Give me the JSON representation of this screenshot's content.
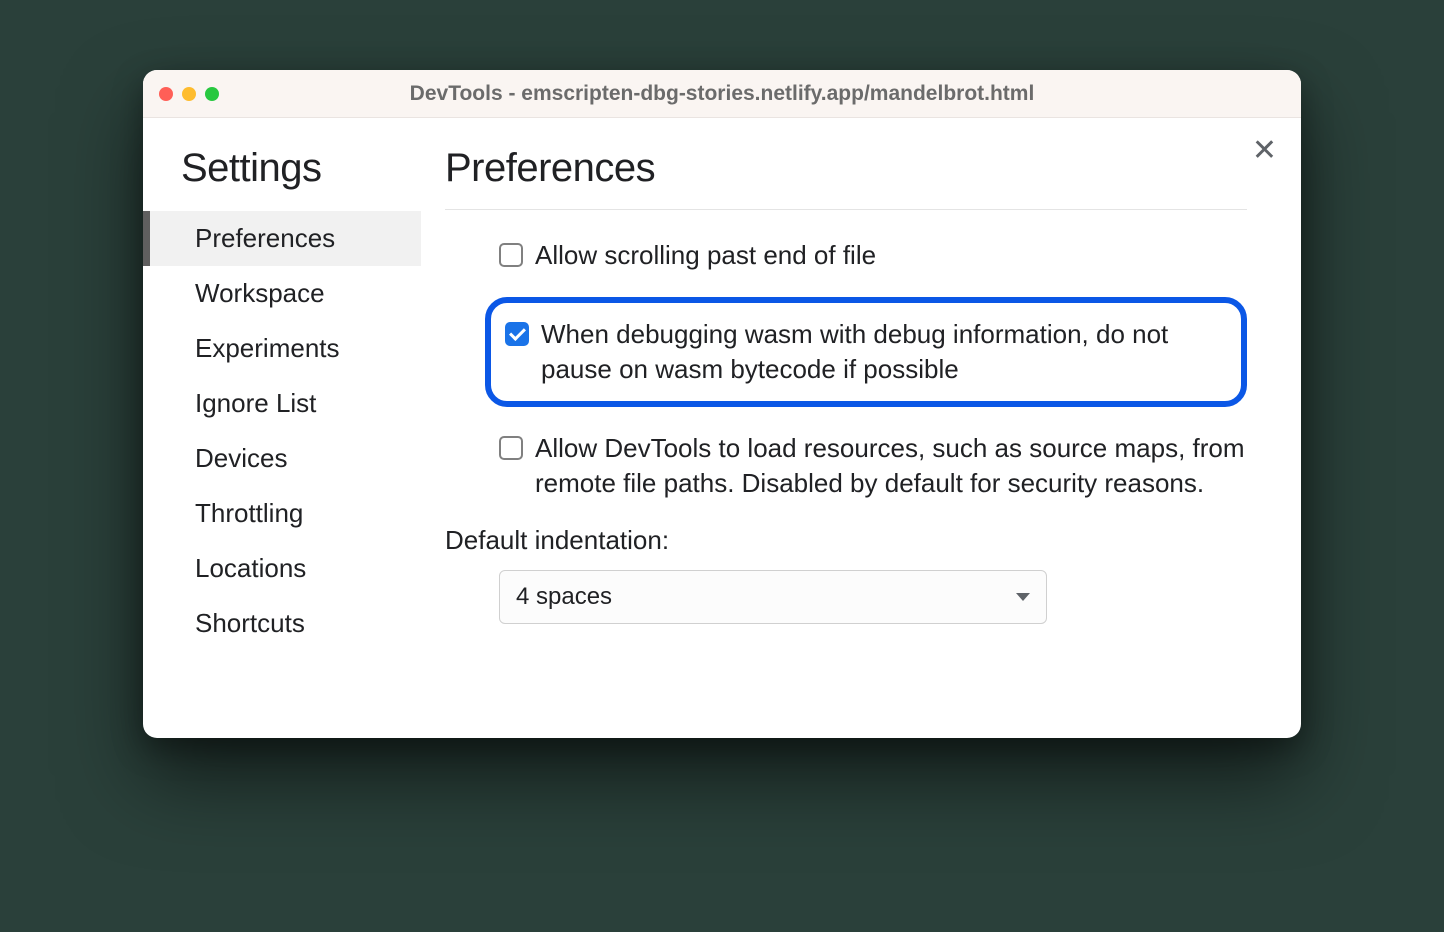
{
  "window": {
    "title": "DevTools - emscripten-dbg-stories.netlify.app/mandelbrot.html"
  },
  "sidebar": {
    "title": "Settings",
    "items": [
      {
        "label": "Preferences",
        "active": true
      },
      {
        "label": "Workspace",
        "active": false
      },
      {
        "label": "Experiments",
        "active": false
      },
      {
        "label": "Ignore List",
        "active": false
      },
      {
        "label": "Devices",
        "active": false
      },
      {
        "label": "Throttling",
        "active": false
      },
      {
        "label": "Locations",
        "active": false
      },
      {
        "label": "Shortcuts",
        "active": false
      }
    ]
  },
  "main": {
    "title": "Preferences",
    "options": [
      {
        "label": "Allow scrolling past end of file",
        "checked": false,
        "highlighted": false
      },
      {
        "label": "When debugging wasm with debug information, do not pause on wasm bytecode if possible",
        "checked": true,
        "highlighted": true
      },
      {
        "label": "Allow DevTools to load resources, such as source maps, from remote file paths. Disabled by default for security reasons.",
        "checked": false,
        "highlighted": false
      }
    ],
    "indentation": {
      "label": "Default indentation:",
      "value": "4 spaces"
    }
  }
}
